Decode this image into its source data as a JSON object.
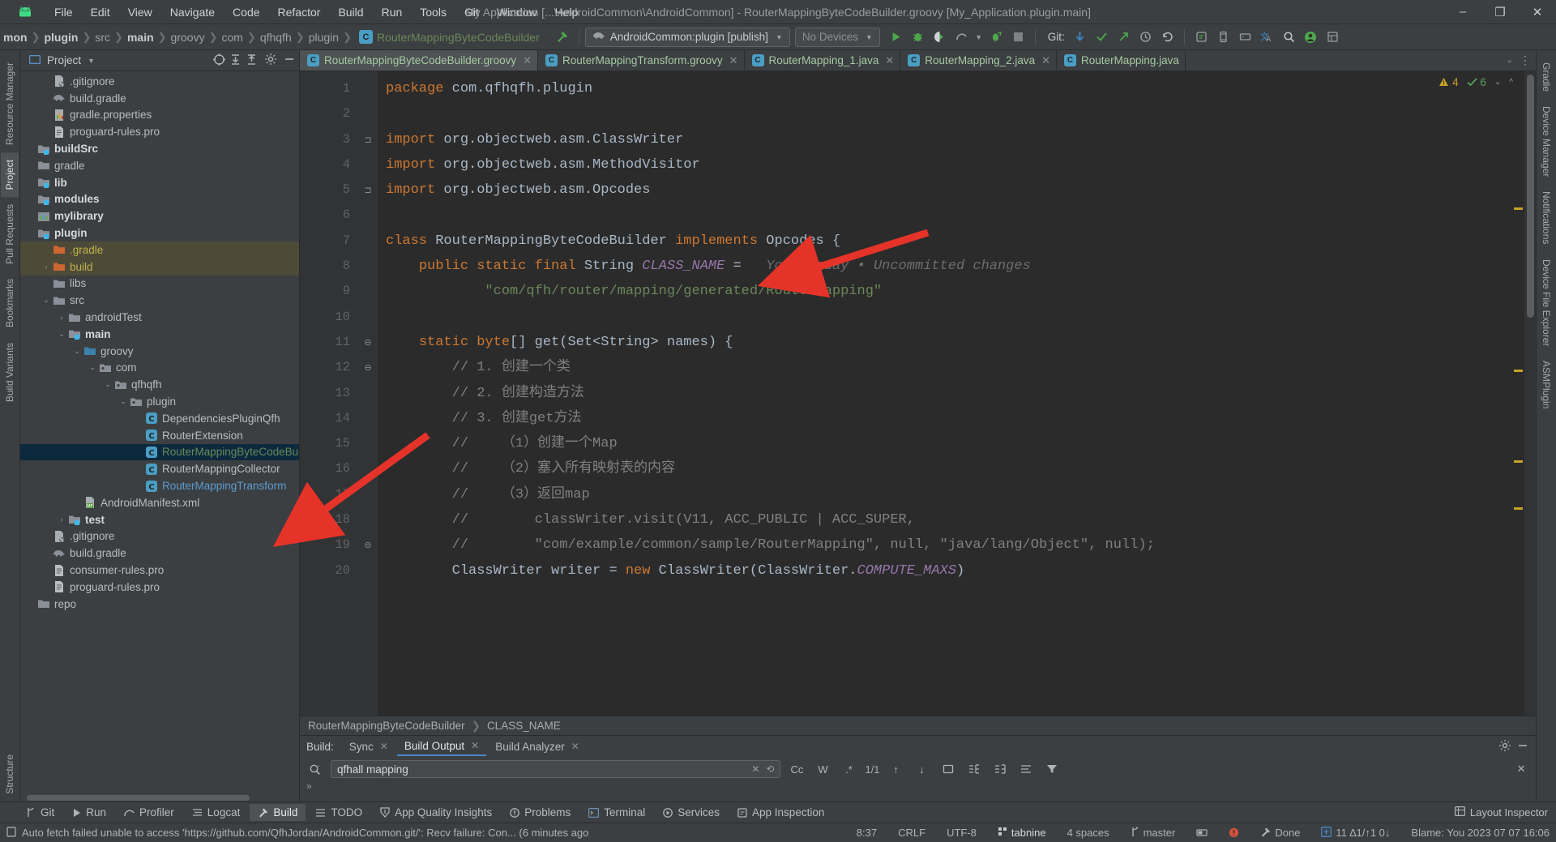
{
  "window": {
    "title": "My Application [...\\AndroidCommon\\AndroidCommon] - RouterMappingByteCodeBuilder.groovy [My_Application.plugin.main]",
    "minimize": "–",
    "maximize": "❐",
    "close": "✕"
  },
  "menu": [
    {
      "label": "File"
    },
    {
      "label": "Edit"
    },
    {
      "label": "View"
    },
    {
      "label": "Navigate"
    },
    {
      "label": "Code"
    },
    {
      "label": "Refactor"
    },
    {
      "label": "Build"
    },
    {
      "label": "Run"
    },
    {
      "label": "Tools"
    },
    {
      "label": "Git"
    },
    {
      "label": "Window"
    },
    {
      "label": "Help"
    }
  ],
  "navbar": {
    "breadcrumbs": [
      {
        "label": "mon",
        "bold": true
      },
      {
        "label": "plugin",
        "bold": true
      },
      {
        "label": "src",
        "bold": false
      },
      {
        "label": "main",
        "bold": true
      },
      {
        "label": "groovy",
        "bold": false
      },
      {
        "label": "com",
        "bold": false
      },
      {
        "label": "qfhqfh",
        "bold": false
      },
      {
        "label": "plugin",
        "bold": false
      }
    ],
    "current_file": "RouterMappingByteCodeBuilder",
    "class_badge": "C",
    "run_config": "AndroidCommon:plugin [publish]",
    "device": "No Devices",
    "git_label": "Git:"
  },
  "project_panel": {
    "title": "Project",
    "tree": [
      {
        "label": ".gitignore",
        "indent": 1,
        "icon": "gitignore-icon",
        "arrow": "",
        "bold": false,
        "color": "",
        "state": ""
      },
      {
        "label": "build.gradle",
        "indent": 1,
        "icon": "gradle-icon",
        "arrow": "",
        "bold": false,
        "color": "",
        "state": ""
      },
      {
        "label": "gradle.properties",
        "indent": 1,
        "icon": "properties-icon",
        "arrow": "",
        "bold": false,
        "color": "",
        "state": ""
      },
      {
        "label": "proguard-rules.pro",
        "indent": 1,
        "icon": "text-icon",
        "arrow": "",
        "bold": false,
        "color": "",
        "state": ""
      },
      {
        "label": "buildSrc",
        "indent": 0,
        "icon": "module-icon",
        "arrow": "",
        "bold": true,
        "color": "",
        "state": ""
      },
      {
        "label": "gradle",
        "indent": 0,
        "icon": "folder-icon",
        "arrow": "",
        "bold": false,
        "color": "",
        "state": ""
      },
      {
        "label": "lib",
        "indent": 0,
        "icon": "module-icon",
        "arrow": "",
        "bold": true,
        "color": "",
        "state": ""
      },
      {
        "label": "modules",
        "indent": 0,
        "icon": "module-icon",
        "arrow": "",
        "bold": true,
        "color": "",
        "state": ""
      },
      {
        "label": "mylibrary",
        "indent": 0,
        "icon": "library-icon",
        "arrow": "",
        "bold": true,
        "color": "",
        "state": ""
      },
      {
        "label": "plugin",
        "indent": 0,
        "icon": "module-icon",
        "arrow": "",
        "bold": true,
        "color": "",
        "state": ""
      },
      {
        "label": ".gradle",
        "indent": 1,
        "icon": "folder-orange-icon",
        "arrow": "",
        "bold": false,
        "color": "yel",
        "state": "hl"
      },
      {
        "label": "build",
        "indent": 1,
        "icon": "folder-orange-icon",
        "arrow": "›",
        "bold": false,
        "color": "yel",
        "state": "hl"
      },
      {
        "label": "libs",
        "indent": 1,
        "icon": "folder-icon",
        "arrow": "",
        "bold": false,
        "color": "",
        "state": ""
      },
      {
        "label": "src",
        "indent": 1,
        "icon": "folder-icon",
        "arrow": "⌄",
        "bold": false,
        "color": "",
        "state": ""
      },
      {
        "label": "androidTest",
        "indent": 2,
        "icon": "folder-icon",
        "arrow": "›",
        "bold": false,
        "color": "",
        "state": ""
      },
      {
        "label": "main",
        "indent": 2,
        "icon": "module-icon",
        "arrow": "⌄",
        "bold": true,
        "color": "",
        "state": ""
      },
      {
        "label": "groovy",
        "indent": 3,
        "icon": "source-root-icon",
        "arrow": "⌄",
        "bold": false,
        "color": "",
        "state": ""
      },
      {
        "label": "com",
        "indent": 4,
        "icon": "package-icon",
        "arrow": "⌄",
        "bold": false,
        "color": "",
        "state": ""
      },
      {
        "label": "qfhqfh",
        "indent": 5,
        "icon": "package-icon",
        "arrow": "⌄",
        "bold": false,
        "color": "",
        "state": ""
      },
      {
        "label": "plugin",
        "indent": 6,
        "icon": "package-icon",
        "arrow": "⌄",
        "bold": false,
        "color": "",
        "state": ""
      },
      {
        "label": "DependenciesPluginQfh",
        "indent": 7,
        "icon": "class-icon",
        "arrow": "",
        "bold": false,
        "color": "",
        "state": ""
      },
      {
        "label": "RouterExtension",
        "indent": 7,
        "icon": "class-icon",
        "arrow": "",
        "bold": false,
        "color": "",
        "state": ""
      },
      {
        "label": "RouterMappingByteCodeBuilder",
        "indent": 7,
        "icon": "class-icon",
        "arrow": "",
        "bold": false,
        "color": "grn",
        "state": "sel"
      },
      {
        "label": "RouterMappingCollector",
        "indent": 7,
        "icon": "class-icon",
        "arrow": "",
        "bold": false,
        "color": "",
        "state": ""
      },
      {
        "label": "RouterMappingTransform",
        "indent": 7,
        "icon": "class-icon",
        "arrow": "",
        "bold": false,
        "color": "blu",
        "state": ""
      },
      {
        "label": "AndroidManifest.xml",
        "indent": 3,
        "icon": "manifest-icon",
        "arrow": "",
        "bold": false,
        "color": "",
        "state": ""
      },
      {
        "label": "test",
        "indent": 2,
        "icon": "module-icon",
        "arrow": "›",
        "bold": true,
        "color": "",
        "state": ""
      },
      {
        "label": ".gitignore",
        "indent": 1,
        "icon": "gitignore-icon",
        "arrow": "",
        "bold": false,
        "color": "",
        "state": ""
      },
      {
        "label": "build.gradle",
        "indent": 1,
        "icon": "gradle-icon",
        "arrow": "",
        "bold": false,
        "color": "",
        "state": ""
      },
      {
        "label": "consumer-rules.pro",
        "indent": 1,
        "icon": "text-icon",
        "arrow": "",
        "bold": false,
        "color": "",
        "state": ""
      },
      {
        "label": "proguard-rules.pro",
        "indent": 1,
        "icon": "text-icon",
        "arrow": "",
        "bold": false,
        "color": "",
        "state": ""
      },
      {
        "label": "repo",
        "indent": 0,
        "icon": "folder-icon",
        "arrow": "",
        "bold": false,
        "color": "",
        "state": ""
      }
    ]
  },
  "left_rail": [
    {
      "label": "Resource Manager"
    },
    {
      "label": "Project",
      "active": true
    },
    {
      "label": "Pull Requests"
    },
    {
      "label": "Bookmarks"
    },
    {
      "label": "Build Variants"
    },
    {
      "label": "Structure"
    }
  ],
  "right_rail": [
    {
      "label": "Gradle"
    },
    {
      "label": "Device Manager"
    },
    {
      "label": "Notifications"
    },
    {
      "label": "Device File Explorer"
    },
    {
      "label": "ASMPlugin"
    }
  ],
  "editor_tabs": [
    {
      "label": "RouterMappingByteCodeBuilder.groovy",
      "active": true,
      "badge": "C"
    },
    {
      "label": "RouterMappingTransform.groovy",
      "active": false,
      "badge": "C"
    },
    {
      "label": "RouterMapping_1.java",
      "active": false,
      "badge": "C"
    },
    {
      "label": "RouterMapping_2.java",
      "active": false,
      "badge": "C"
    },
    {
      "label": "RouterMapping.java",
      "active": false,
      "badge": "C"
    }
  ],
  "inspection": {
    "warnings": "4",
    "errors": "6"
  },
  "code_lines": [
    {
      "n": "1",
      "fold": "",
      "html": "<span class='kw'>package</span> com.qfhqfh.plugin"
    },
    {
      "n": "2",
      "fold": "",
      "html": ""
    },
    {
      "n": "3",
      "fold": "⊐",
      "html": "<span class='kw'>import</span> org.objectweb.asm.ClassWriter"
    },
    {
      "n": "4",
      "fold": "",
      "html": "<span class='kw'>import</span> org.objectweb.asm.MethodVisitor"
    },
    {
      "n": "5",
      "fold": "⊐",
      "html": "<span class='kw'>import</span> org.objectweb.asm.Opcodes"
    },
    {
      "n": "6",
      "fold": "",
      "html": ""
    },
    {
      "n": "7",
      "fold": "",
      "html": "<span class='kw'>class</span> RouterMappingByteCodeBuilder <span class='kw'>implements</span> Opcodes {"
    },
    {
      "n": "8",
      "fold": "",
      "html": "    <span class='kw'>public static final</span> String <span class='cst'>CLASS_NAME</span> =   <span class='hint'>You, Today • Uncommitted changes</span>"
    },
    {
      "n": "9",
      "fold": "",
      "html": "            <span class='str'>\"com/qfh/router/mapping/generated/RouterMapping\"</span>"
    },
    {
      "n": "10",
      "fold": "",
      "html": ""
    },
    {
      "n": "11",
      "fold": "⊖",
      "html": "    <span class='kw'>static</span> <span class='kw'>byte</span>[] get(Set&lt;String&gt; names) {"
    },
    {
      "n": "12",
      "fold": "⊖",
      "html": "        <span class='cmt'>// 1. 创建一个类</span>"
    },
    {
      "n": "13",
      "fold": "",
      "html": "        <span class='cmt'>// 2. 创建构造方法</span>"
    },
    {
      "n": "14",
      "fold": "",
      "html": "        <span class='cmt'>// 3. 创建get方法</span>"
    },
    {
      "n": "15",
      "fold": "",
      "html": "        <span class='cmt'>//    （1）创建一个Map</span>"
    },
    {
      "n": "16",
      "fold": "",
      "html": "        <span class='cmt'>//    （2）塞入所有映射表的内容</span>"
    },
    {
      "n": "17",
      "fold": "",
      "html": "        <span class='cmt'>//    （3）返回map</span>"
    },
    {
      "n": "18",
      "fold": "",
      "html": "        <span class='cmt'>//        classWriter.visit(V11, ACC_PUBLIC | ACC_SUPER,</span>"
    },
    {
      "n": "19",
      "fold": "⊖",
      "html": "        <span class='cmt'>//        \"com/example/common/sample/RouterMapping\", null, \"java/lang/Object\", null);</span>"
    },
    {
      "n": "20",
      "fold": "",
      "html": "        ClassWriter writer = <span class='kw'>new</span> ClassWriter(ClassWriter.<span class='cst'>COMPUTE_MAXS</span>)"
    }
  ],
  "editor_breadcrumbs": [
    "RouterMappingByteCodeBuilder",
    "CLASS_NAME"
  ],
  "build_window": {
    "label": "Build:",
    "tabs": [
      {
        "label": "Sync",
        "active": false,
        "closable": true
      },
      {
        "label": "Build Output",
        "active": true,
        "closable": true
      },
      {
        "label": "Build Analyzer",
        "active": false,
        "closable": true
      }
    ],
    "search_value": "qfhall mapping",
    "search_icon": "search-icon",
    "match_case": "Cc",
    "words": "W",
    "counter": "1/1"
  },
  "bottom_tools": [
    {
      "label": "Git",
      "icon": "branch-icon",
      "active": false
    },
    {
      "label": "Run",
      "icon": "play-icon",
      "active": false
    },
    {
      "label": "Profiler",
      "icon": "profiler-icon",
      "active": false
    },
    {
      "label": "Logcat",
      "icon": "logcat-icon",
      "active": false
    },
    {
      "label": "Build",
      "icon": "hammer-icon",
      "active": true
    },
    {
      "label": "TODO",
      "icon": "todo-icon",
      "active": false
    },
    {
      "label": "App Quality Insights",
      "icon": "shield-icon",
      "active": false
    },
    {
      "label": "Problems",
      "icon": "problems-icon",
      "active": false
    },
    {
      "label": "Terminal",
      "icon": "terminal-icon",
      "active": false
    },
    {
      "label": "Services",
      "icon": "services-icon",
      "active": false
    },
    {
      "label": "App Inspection",
      "icon": "inspection-icon",
      "active": false
    }
  ],
  "layout_inspector": "Layout Inspector",
  "status_bar": {
    "message": "Auto fetch failed unable to access 'https://github.com/QfhJordan/AndroidCommon.git/': Recv failure: Con... (6 minutes ago",
    "caret": "8:37",
    "line_sep": "CRLF",
    "encoding": "UTF-8",
    "tabnine": "tabnine",
    "indent": "4 spaces",
    "branch": "master",
    "done": "Done",
    "counters": "11 ∆1/↑1 0↓",
    "blame": "Blame: You 2023 07 07 16:06"
  },
  "colors": {
    "bg": "#3c3f41",
    "editor_bg": "#2b2b2b",
    "accent_blue": "#4a88c7",
    "selection": "#0d293e",
    "string_green": "#6a8759",
    "keyword_orange": "#cc7832",
    "arrow_red": "#e63329"
  }
}
